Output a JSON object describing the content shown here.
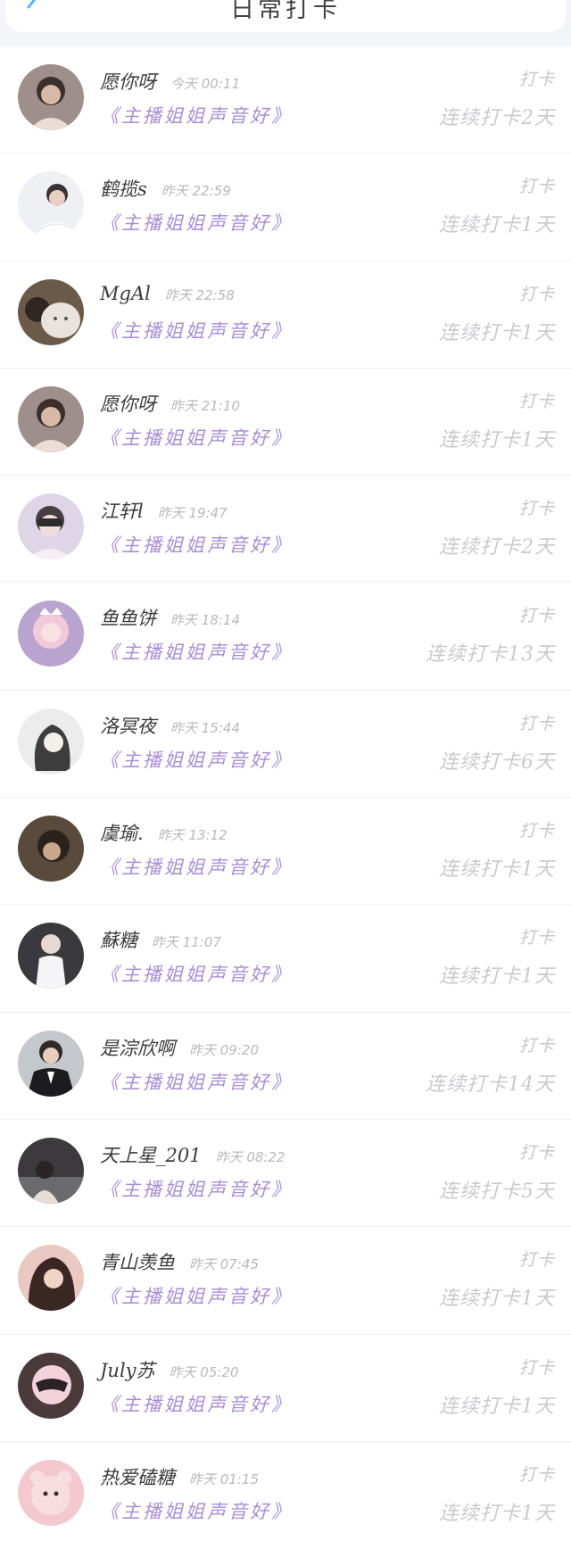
{
  "header": {
    "title": "日常打卡",
    "back_icon": "chevron-left-icon"
  },
  "colors": {
    "accent_purple": "#a98fd6",
    "back_blue": "#5ab4f0",
    "muted_gray": "#c7c7cb"
  },
  "entries": [
    {
      "username": "愿你呀",
      "time": "今天 00:11",
      "book": "《主播姐姐声音好》",
      "checkin_label": "打卡",
      "streak": "连续打卡2天"
    },
    {
      "username": "鹤揽s",
      "time": "昨天 22:59",
      "book": "《主播姐姐声音好》",
      "checkin_label": "打卡",
      "streak": "连续打卡1天"
    },
    {
      "username": "MgAl",
      "time": "昨天 22:58",
      "book": "《主播姐姐声音好》",
      "checkin_label": "打卡",
      "streak": "连续打卡1天"
    },
    {
      "username": "愿你呀",
      "time": "昨天 21:10",
      "book": "《主播姐姐声音好》",
      "checkin_label": "打卡",
      "streak": "连续打卡1天"
    },
    {
      "username": "江轩l",
      "time": "昨天 19:47",
      "book": "《主播姐姐声音好》",
      "checkin_label": "打卡",
      "streak": "连续打卡2天"
    },
    {
      "username": "鱼鱼饼",
      "time": "昨天 18:14",
      "book": "《主播姐姐声音好》",
      "checkin_label": "打卡",
      "streak": "连续打卡13天"
    },
    {
      "username": "洛冥夜",
      "time": "昨天 15:44",
      "book": "《主播姐姐声音好》",
      "checkin_label": "打卡",
      "streak": "连续打卡6天"
    },
    {
      "username": "虞瑜.",
      "time": "昨天 13:12",
      "book": "《主播姐姐声音好》",
      "checkin_label": "打卡",
      "streak": "连续打卡1天"
    },
    {
      "username": "蘇糖",
      "time": "昨天 11:07",
      "book": "《主播姐姐声音好》",
      "checkin_label": "打卡",
      "streak": "连续打卡1天"
    },
    {
      "username": "是淙欣啊",
      "time": "昨天 09:20",
      "book": "《主播姐姐声音好》",
      "checkin_label": "打卡",
      "streak": "连续打卡14天"
    },
    {
      "username": "天上星_201",
      "time": "昨天 08:22",
      "book": "《主播姐姐声音好》",
      "checkin_label": "打卡",
      "streak": "连续打卡5天"
    },
    {
      "username": "青山羡鱼",
      "time": "昨天 07:45",
      "book": "《主播姐姐声音好》",
      "checkin_label": "打卡",
      "streak": "连续打卡1天"
    },
    {
      "username": "July苏",
      "time": "昨天 05:20",
      "book": "《主播姐姐声音好》",
      "checkin_label": "打卡",
      "streak": "连续打卡1天"
    },
    {
      "username": "热爱磕糖",
      "time": "昨天 01:15",
      "book": "《主播姐姐声音好》",
      "checkin_label": "打卡",
      "streak": "连续打卡1天"
    }
  ]
}
